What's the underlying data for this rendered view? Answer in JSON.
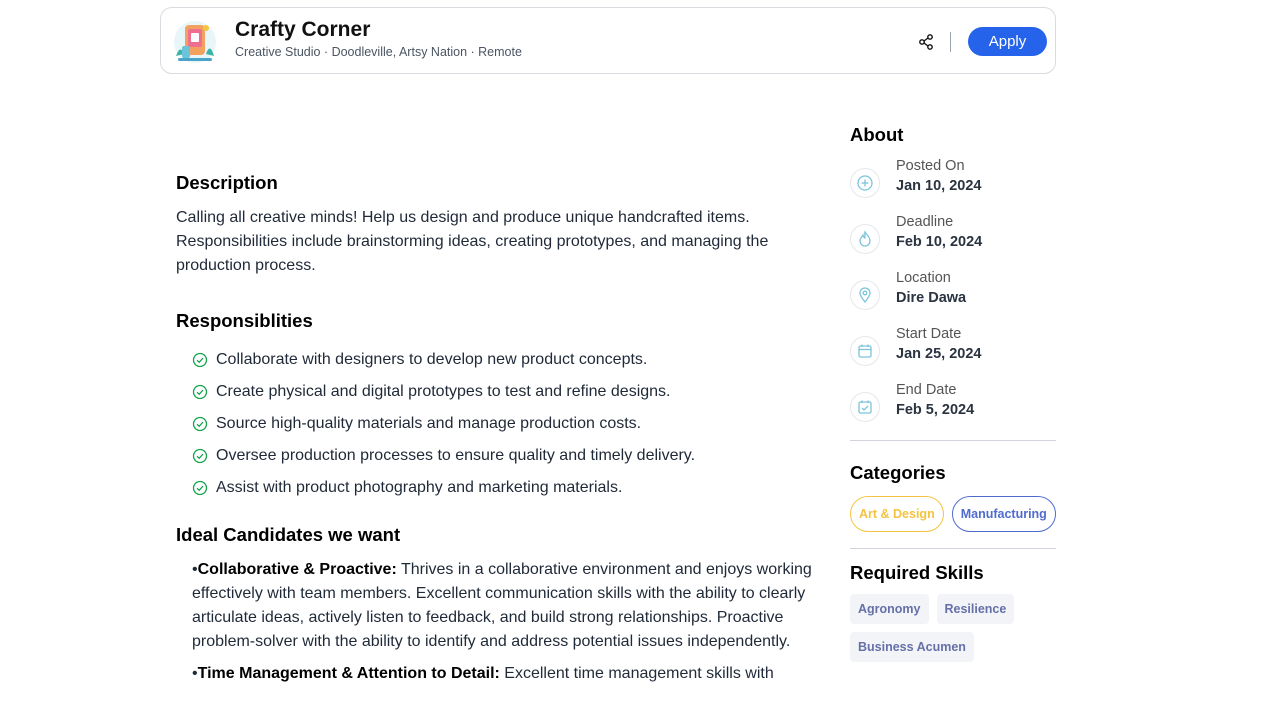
{
  "company": {
    "name": "Crafty Corner",
    "meta": "Creative Studio · Doodleville, Artsy Nation · Remote"
  },
  "header": {
    "apply_label": "Apply",
    "share_icon": "share-icon",
    "accent_color": "#2563eb"
  },
  "description": {
    "title": "Description",
    "text": "Calling all creative minds! Help us design and produce unique handcrafted items. Responsibilities include brainstorming ideas, creating prototypes, and managing the production process."
  },
  "responsibilities": {
    "title": "Responsiblities",
    "items": [
      "Collaborate with designers to develop new product concepts.",
      "Create physical and digital prototypes to test and refine designs.",
      "Source high-quality materials and manage production costs.",
      "Oversee production processes to ensure quality and timely delivery.",
      "Assist with product photography and marketing materials."
    ]
  },
  "ideal": {
    "title": "Ideal Candidates we want",
    "items": [
      {
        "heading": "Collaborative & Proactive:",
        "text": " Thrives in a collaborative environment and enjoys working effectively with team members. Excellent communication skills with the ability to clearly articulate ideas, actively listen to feedback, and build strong relationships. Proactive problem-solver with the ability to identify and address potential issues independently."
      },
      {
        "heading": "Time Management & Attention to Detail:",
        "text": " Excellent time management skills with"
      }
    ]
  },
  "about": {
    "title": "About",
    "rows": [
      {
        "label": "Posted On",
        "value": "Jan 10, 2024",
        "icon": "plus-circle-icon"
      },
      {
        "label": "Deadline",
        "value": "Feb 10, 2024",
        "icon": "flame-icon"
      },
      {
        "label": "Location",
        "value": "Dire Dawa",
        "icon": "map-pin-icon"
      },
      {
        "label": "Start Date",
        "value": "Jan 25, 2024",
        "icon": "calendar-icon"
      },
      {
        "label": "End Date",
        "value": "Feb 5, 2024",
        "icon": "calendar-check-icon"
      }
    ]
  },
  "categories": {
    "title": "Categories",
    "items": [
      "Art & Design",
      "Manufacturing"
    ]
  },
  "skills": {
    "title": "Required Skills",
    "items": [
      "Agronomy",
      "Resilience",
      "Business Acumen"
    ]
  }
}
